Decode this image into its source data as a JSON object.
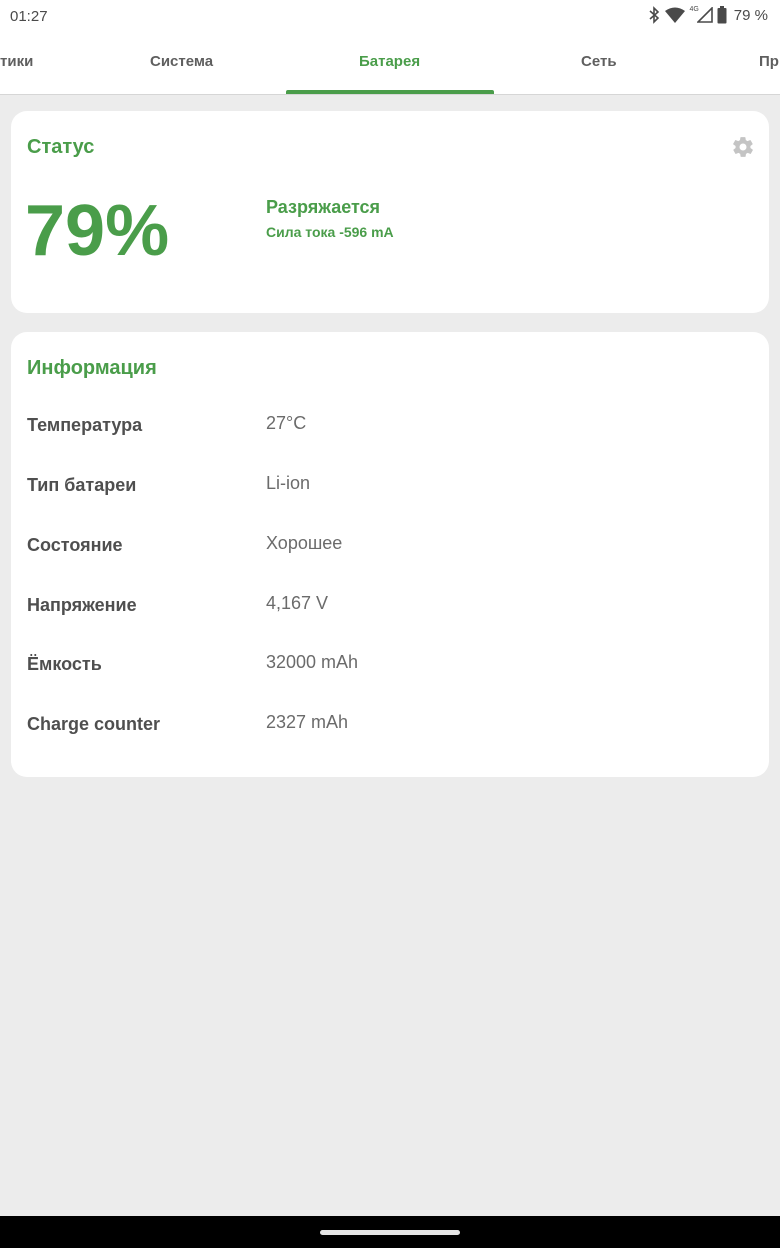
{
  "status_bar": {
    "time": "01:27",
    "network_badge": "4G",
    "battery_percent": "79 %",
    "icons": [
      "bluetooth-icon",
      "wifi-icon",
      "cell-signal-icon",
      "battery-icon"
    ]
  },
  "tabs": [
    {
      "label": "тики",
      "active": false
    },
    {
      "label": "Система",
      "active": false
    },
    {
      "label": "Батарея",
      "active": true
    },
    {
      "label": "Сеть",
      "active": false
    },
    {
      "label": "Пр",
      "active": false
    }
  ],
  "status_card": {
    "title": "Статус",
    "percent": "79%",
    "state": "Разряжается",
    "current": "Сила тока -596 mA",
    "settings_icon": "gear-icon"
  },
  "info_card": {
    "title": "Информация",
    "rows": [
      {
        "label": "Температура",
        "value": "27°C"
      },
      {
        "label": "Тип батареи",
        "value": "Li-ion"
      },
      {
        "label": "Состояние",
        "value": "Хорошее"
      },
      {
        "label": "Напряжение",
        "value": "4,167 V"
      },
      {
        "label": "Ёмкость",
        "value": "32000 mAh"
      },
      {
        "label": "Charge counter",
        "value": "2327 mAh"
      }
    ]
  },
  "colors": {
    "accent": "#4a9d4a",
    "background": "#ececec",
    "card": "#ffffff",
    "label_text": "#4f4f4f",
    "value_text": "#6b6b6b"
  }
}
